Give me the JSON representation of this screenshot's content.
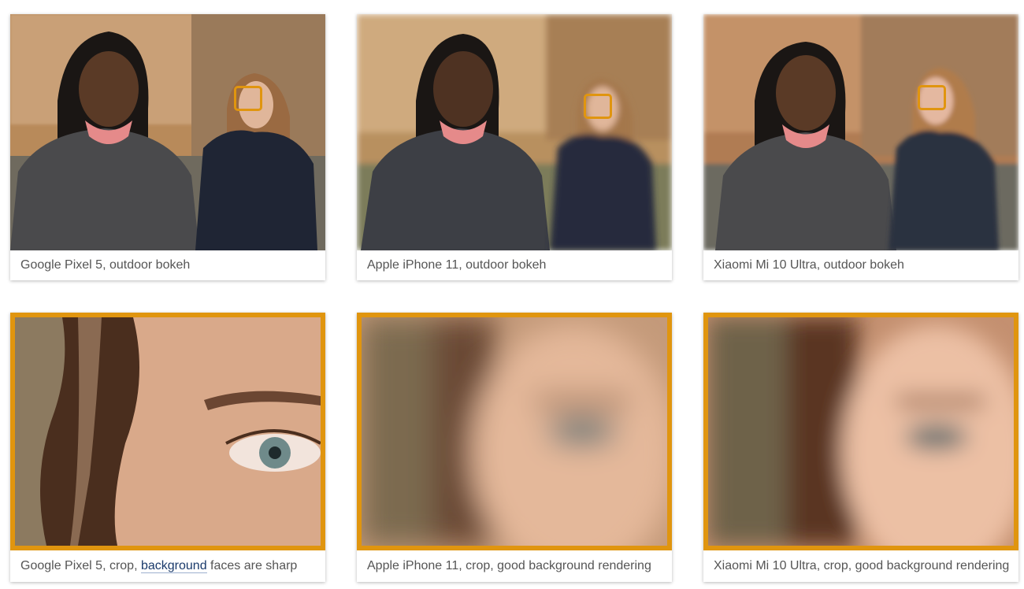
{
  "cards": [
    {
      "caption": "Google Pixel 5, outdoor bokeh"
    },
    {
      "caption": "Apple iPhone 11, outdoor bokeh"
    },
    {
      "caption": "Xiaomi Mi 10 Ultra, outdoor bokeh"
    },
    {
      "caption_prefix": "Google Pixel 5, crop, ",
      "caption_link": "background",
      "caption_suffix": " faces are sharp"
    },
    {
      "caption": "Apple iPhone 11, crop, good background rendering"
    },
    {
      "caption": "Xiaomi Mi 10 Ultra, crop, good background rendering"
    }
  ],
  "colors": {
    "highlight": "#e0950f",
    "link": "#1a3a6b"
  }
}
